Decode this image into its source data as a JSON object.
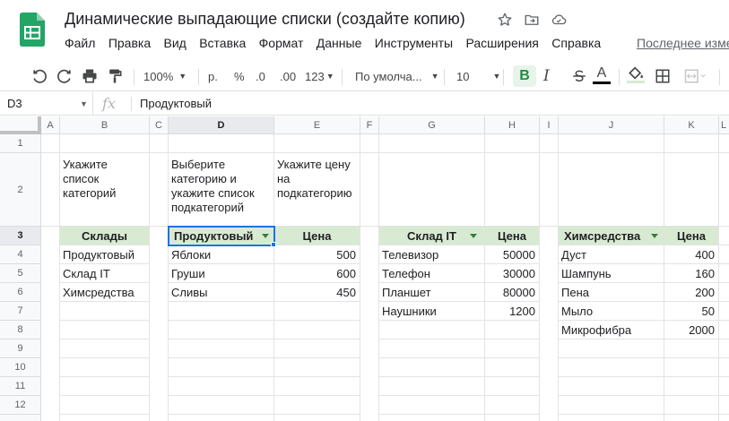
{
  "document": {
    "title": "Динамические выпадающие списки (создайте копию)",
    "last_edit": "Последнее изменение"
  },
  "menu": [
    "Файл",
    "Правка",
    "Вид",
    "Вставка",
    "Формат",
    "Данные",
    "Инструменты",
    "Расширения",
    "Справка"
  ],
  "toolbar": {
    "zoom": "100%",
    "currency": "р.",
    "percent": "%",
    "decrease_decimals": ".0",
    "increase_decimals": ".00",
    "number_format": "123",
    "font": "По умолча...",
    "font_size": "10",
    "bold": "B",
    "italic": "I",
    "text_color": "A"
  },
  "formula_bar": {
    "cell_ref": "D3",
    "fx": "fx",
    "value": "Продуктовый"
  },
  "columns": [
    "A",
    "B",
    "C",
    "D",
    "E",
    "F",
    "G",
    "H",
    "I",
    "J",
    "K",
    "L"
  ],
  "rows": [
    "1",
    "2",
    "3",
    "4",
    "5",
    "6",
    "7",
    "8",
    "9",
    "10",
    "11",
    "12"
  ],
  "active": {
    "column": "D",
    "row": "3"
  },
  "instructions": {
    "b2": "Укажите список категорий",
    "d2": "Выберите категорию и укажите список подкатегорий",
    "e2": "Укажите цену на подкатегорию"
  },
  "tables": {
    "categories": {
      "header": "Склады",
      "items": [
        "Продуктовый",
        "Склад IT",
        "Химсредства"
      ]
    },
    "selected": {
      "header": "Продуктовый",
      "price_header": "Цена",
      "items": [
        {
          "name": "Яблоки",
          "price": "500"
        },
        {
          "name": "Груши",
          "price": "600"
        },
        {
          "name": "Сливы",
          "price": "450"
        }
      ]
    },
    "it": {
      "header": "Склад IT",
      "price_header": "Цена",
      "items": [
        {
          "name": "Телевизор",
          "price": "50000"
        },
        {
          "name": "Телефон",
          "price": "30000"
        },
        {
          "name": "Планшет",
          "price": "80000"
        },
        {
          "name": "Наушники",
          "price": "1200"
        }
      ]
    },
    "chem": {
      "header": "Химсредства",
      "price_header": "Цена",
      "items": [
        {
          "name": "Дуст",
          "price": "400"
        },
        {
          "name": "Шампунь",
          "price": "160"
        },
        {
          "name": "Пена",
          "price": "200"
        },
        {
          "name": "Мыло",
          "price": "50"
        },
        {
          "name": "Микрофибра",
          "price": "2000"
        }
      ]
    }
  },
  "colors": {
    "header_fill": "#d9ead3",
    "selection": "#1a73e8",
    "bold_active": "#1e8e3e"
  }
}
